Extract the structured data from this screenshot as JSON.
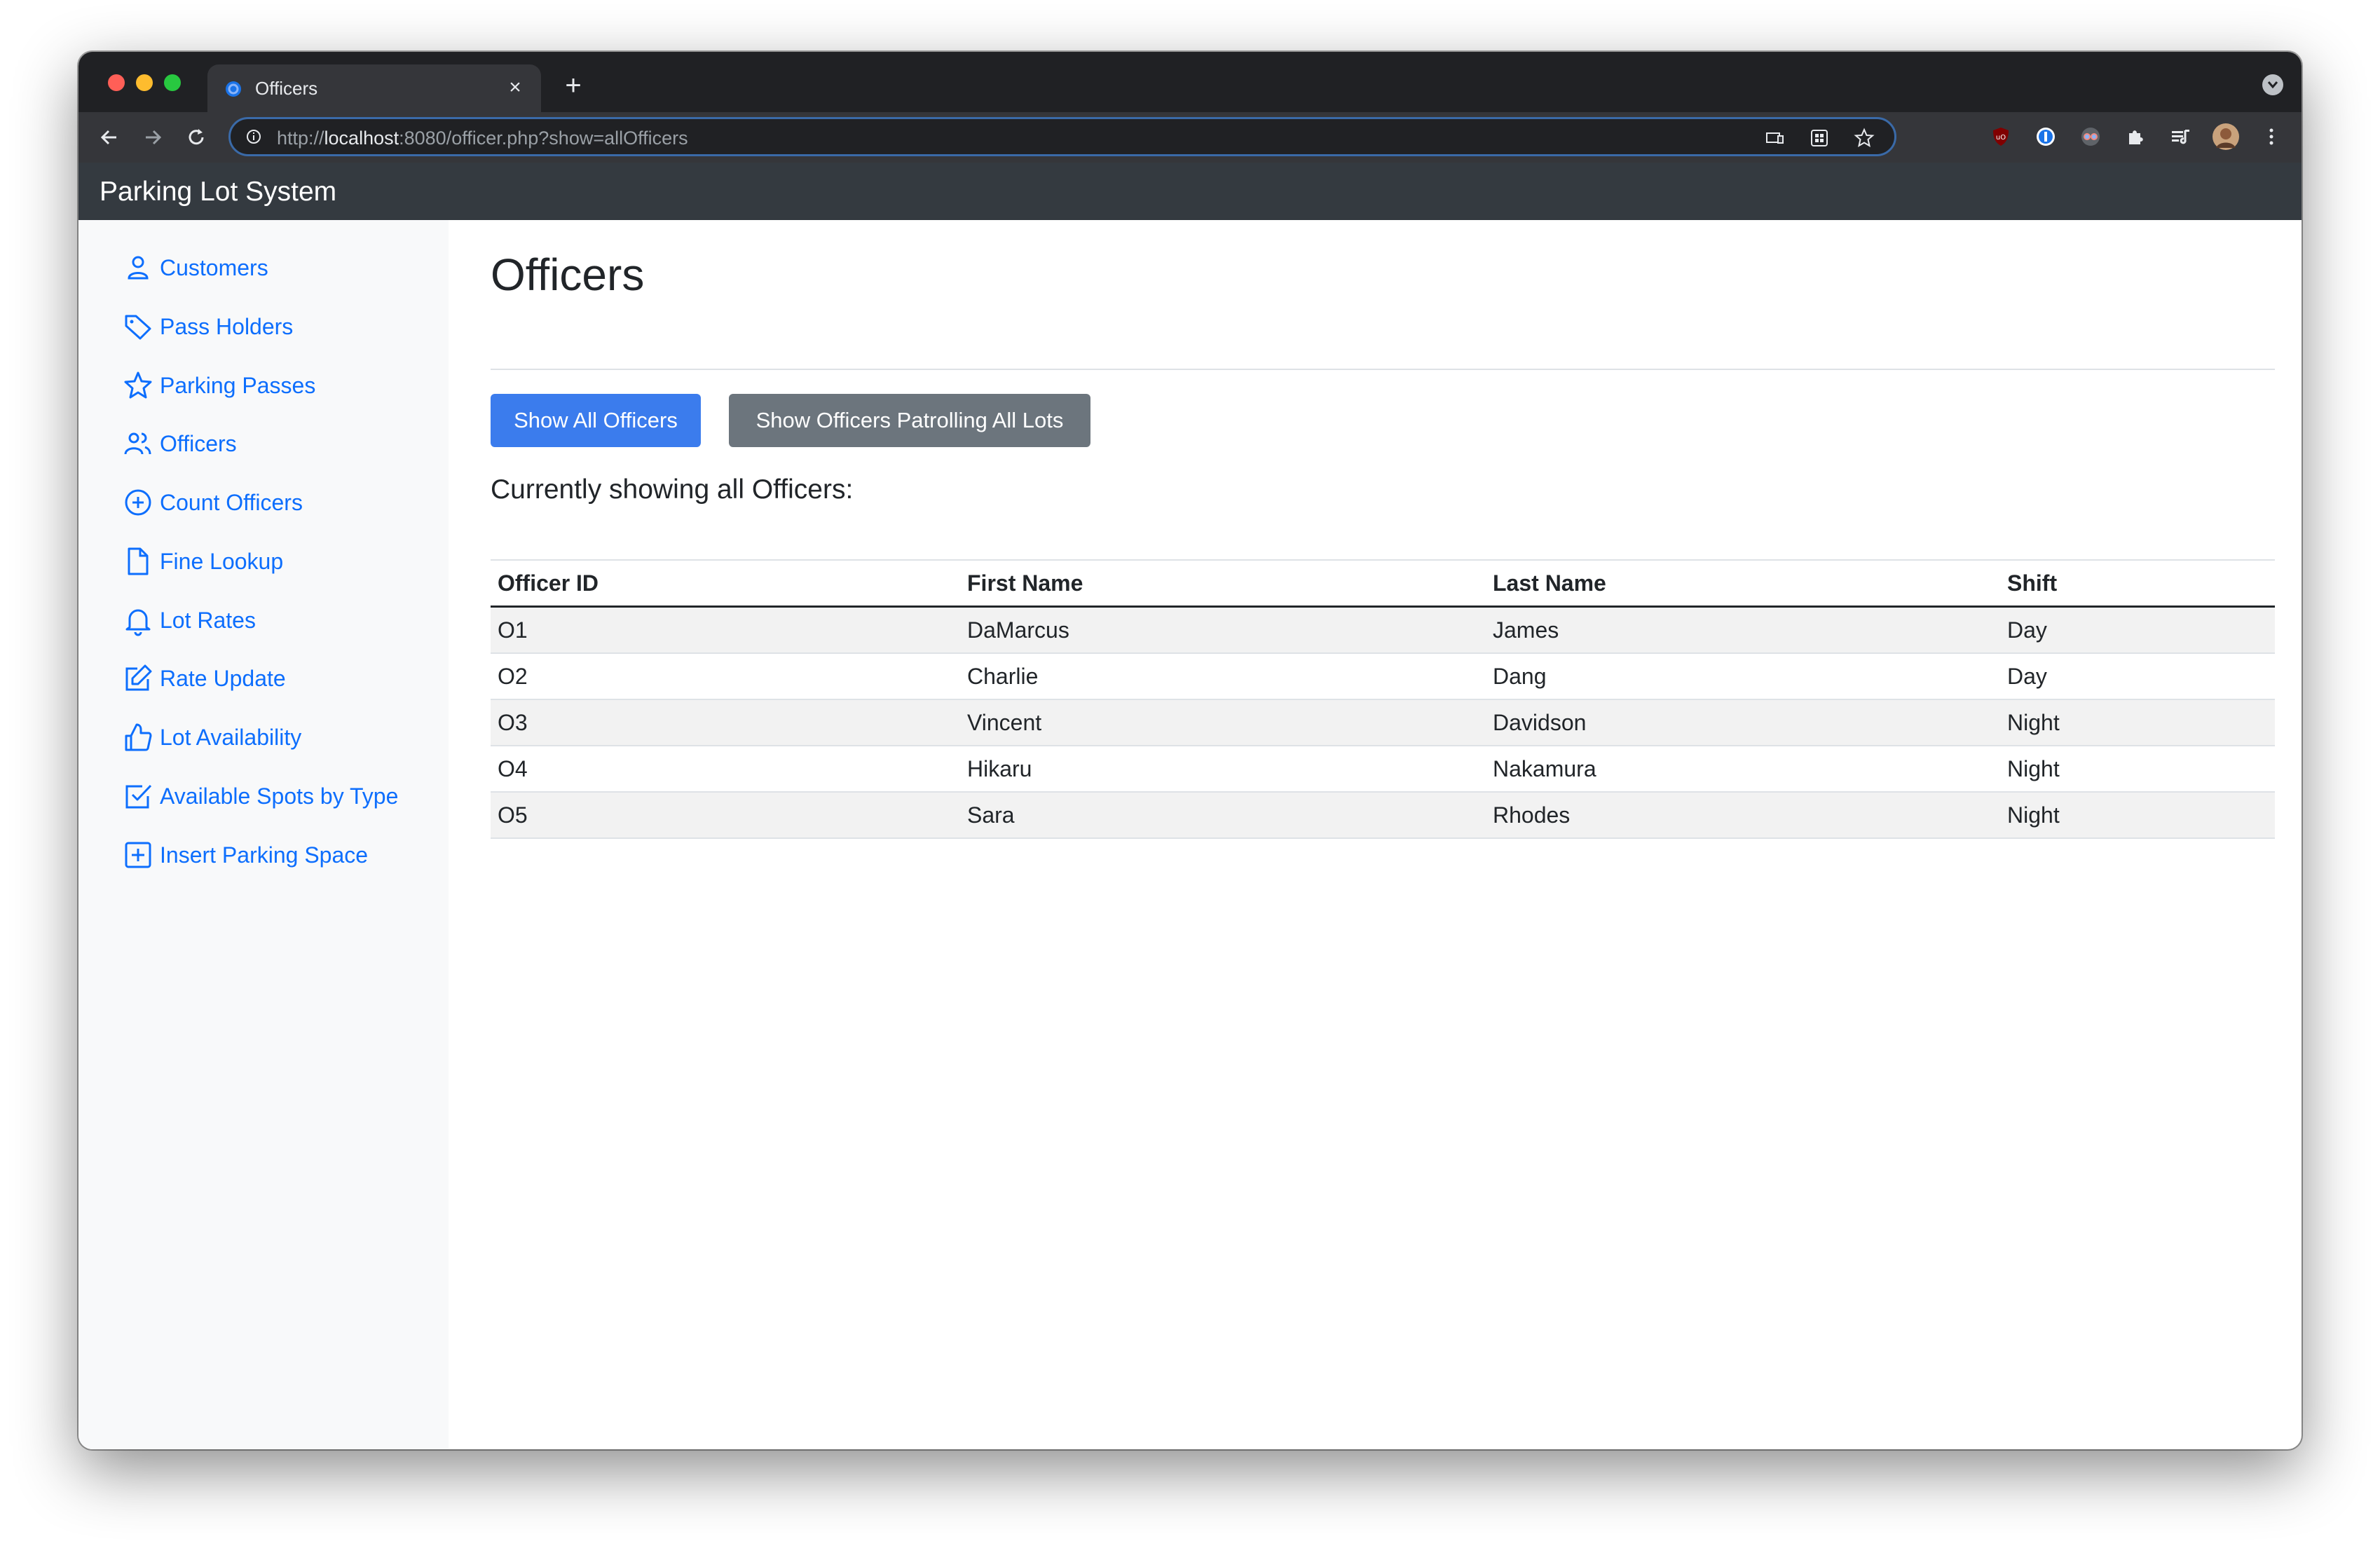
{
  "browser": {
    "tab_title": "Officers",
    "new_tab_symbol": "+",
    "close_symbol": "×",
    "url_prefix": "http://",
    "url_host": "localhost",
    "url_rest": ":8080/officer.php?show=allOfficers"
  },
  "app": {
    "brand": "Parking Lot System"
  },
  "sidebar": {
    "items": [
      {
        "label": "Customers",
        "icon": "person-icon"
      },
      {
        "label": "Pass Holders",
        "icon": "tag-icon"
      },
      {
        "label": "Parking Passes",
        "icon": "star-icon"
      },
      {
        "label": "Officers",
        "icon": "people-icon"
      },
      {
        "label": "Count Officers",
        "icon": "plus-circle-icon"
      },
      {
        "label": "Fine Lookup",
        "icon": "file-icon"
      },
      {
        "label": "Lot Rates",
        "icon": "bell-icon"
      },
      {
        "label": "Rate Update",
        "icon": "edit-icon"
      },
      {
        "label": "Lot Availability",
        "icon": "thumbs-up-icon"
      },
      {
        "label": "Available Spots by Type",
        "icon": "check-square-icon"
      },
      {
        "label": "Insert Parking Space",
        "icon": "plus-square-icon"
      }
    ]
  },
  "main": {
    "title": "Officers",
    "buttons": {
      "show_all": "Show All Officers",
      "show_patrolling": "Show Officers Patrolling All Lots"
    },
    "subtitle": "Currently showing all Officers:",
    "table": {
      "headers": [
        "Officer ID",
        "First Name",
        "Last Name",
        "Shift"
      ],
      "rows": [
        [
          "O1",
          "DaMarcus",
          "James",
          "Day"
        ],
        [
          "O2",
          "Charlie",
          "Dang",
          "Day"
        ],
        [
          "O3",
          "Vincent",
          "Davidson",
          "Night"
        ],
        [
          "O4",
          "Hikaru",
          "Nakamura",
          "Night"
        ],
        [
          "O5",
          "Sara",
          "Rhodes",
          "Night"
        ]
      ]
    }
  },
  "colors": {
    "link": "#0d6efd",
    "primary_button": "#3b7ced",
    "secondary_button": "#6c757d",
    "navbar": "#343a40",
    "sidebar": "#f8f9fa"
  }
}
